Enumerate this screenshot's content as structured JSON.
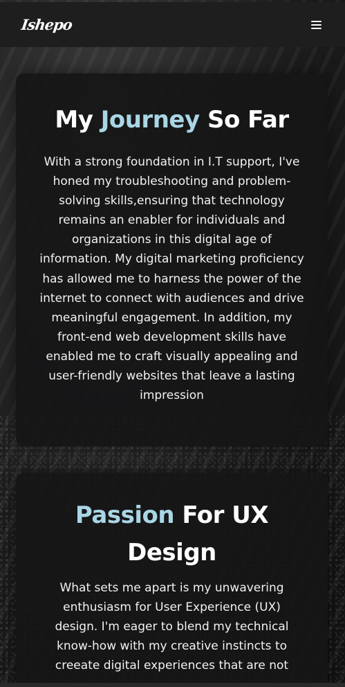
{
  "navbar": {
    "logo_text": "Ishepo",
    "menu_icon": "hamburger-menu-icon"
  },
  "sections": [
    {
      "title_prefix": "My ",
      "title_accent": "Journey",
      "title_suffix": " So Far",
      "body": "With a strong foundation in I.T support, I've honed my troubleshooting and problem-solving skills,ensuring that technology remains an enabler for individuals and organizations in this digital age of information. My digital marketing proficiency has allowed me to harness the power of the internet to connect with audiences and drive meaningful engagement. In addition, my front-end web development skills have enabled me to craft visually appealing and user-friendly websites that leave a lasting impression"
    },
    {
      "title_prefix": "",
      "title_accent": "Passion",
      "title_suffix": " For UX Design",
      "body": "What sets me apart is my unwavering enthusiasm for User Experience (UX) design. I'm eager to blend my technical know-how with my creative instincts to creeate digital experiences that are not"
    }
  ],
  "colors": {
    "accent": "#a9d6e5",
    "card_bg": "#161617",
    "navbar_bg": "#1e1e1f",
    "text": "#ffffff"
  }
}
